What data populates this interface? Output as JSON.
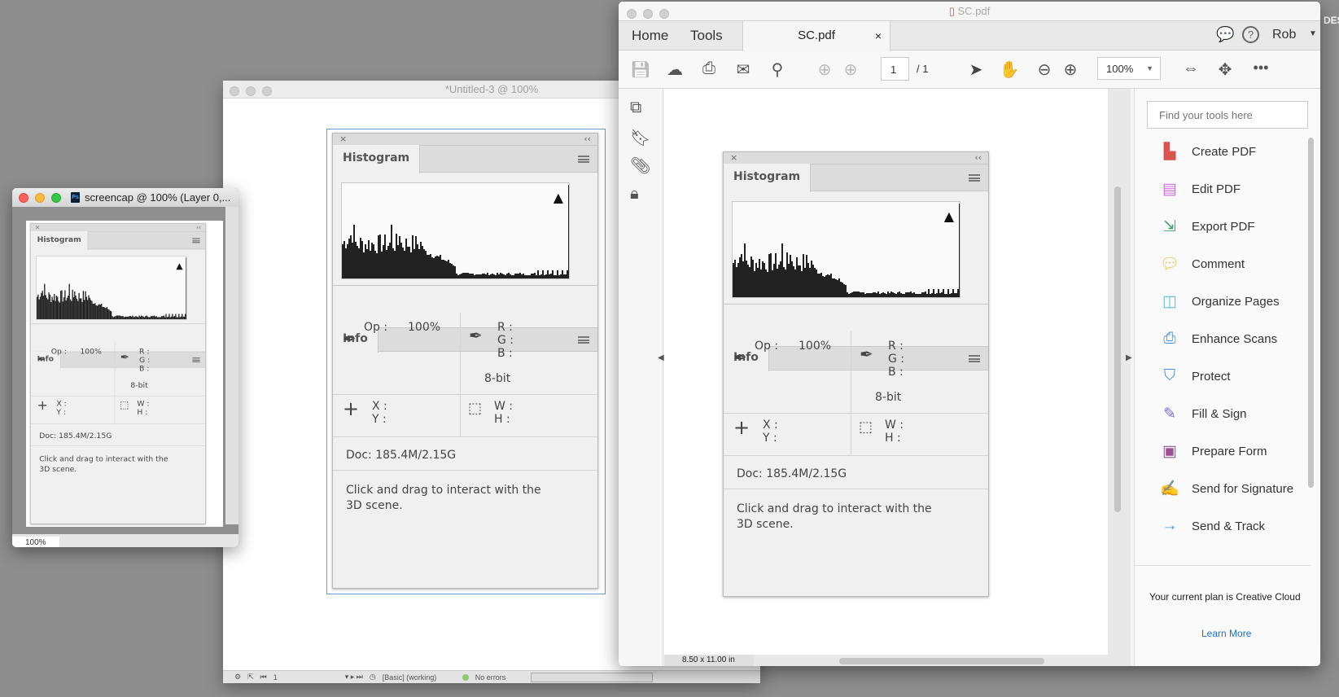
{
  "panel": {
    "histogram_tab": "Histogram",
    "info_tab": "Info",
    "op_label": "Op :",
    "op_value": "100%",
    "r_label": "R :",
    "g_label": "G :",
    "b_label": "B :",
    "bit_depth": "8-bit",
    "x_label": "X :",
    "y_label": "Y :",
    "w_label": "W :",
    "h_label": "H :",
    "doc_info": "Doc: 185.4M/2.15G",
    "hint": "Click and drag to interact with the 3D scene.",
    "close_glyph": "×",
    "collapse_glyph": "‹‹"
  },
  "small_window": {
    "title": "screencap @ 100% (Layer 0,...",
    "zoom": "100%",
    "app_badge": "Ps"
  },
  "untitled_window": {
    "title": "*Untitled-3 @ 100%",
    "status": {
      "page": "1",
      "workspace": "[Basic] (working)",
      "errors": "No errors"
    }
  },
  "acrobat": {
    "title": "SC.pdf",
    "tabs": {
      "home": "Home",
      "tools": "Tools",
      "doc": "SC.pdf"
    },
    "user": "Rob",
    "page_current": "1",
    "page_total": "/ 1",
    "zoom": "100%",
    "page_size": "8.50 x 11.00 in",
    "search_placeholder": "Find your tools here",
    "tools": [
      {
        "label": "Create PDF",
        "icon": "create-pdf",
        "color": "#d9534f"
      },
      {
        "label": "Edit PDF",
        "icon": "edit-pdf",
        "color": "#c86dd7"
      },
      {
        "label": "Export PDF",
        "icon": "export-pdf",
        "color": "#3fa36b"
      },
      {
        "label": "Comment",
        "icon": "comment",
        "color": "#f0c040"
      },
      {
        "label": "Organize Pages",
        "icon": "organize-pages",
        "color": "#5bc0de"
      },
      {
        "label": "Enhance Scans",
        "icon": "enhance-scans",
        "color": "#4a90d9"
      },
      {
        "label": "Protect",
        "icon": "protect",
        "color": "#4a90d9"
      },
      {
        "label": "Fill & Sign",
        "icon": "fill-sign",
        "color": "#7b68ee"
      },
      {
        "label": "Prepare Form",
        "icon": "prepare-form",
        "color": "#9b4f96"
      },
      {
        "label": "Send for Signature",
        "icon": "send-for-signature",
        "color": "#6a5acd"
      },
      {
        "label": "Send & Track",
        "icon": "send-track",
        "color": "#4a90d9"
      }
    ],
    "plan_text": "Your current plan is Creative Cloud",
    "learn_more": "Learn More"
  },
  "desktop_label": "DES"
}
